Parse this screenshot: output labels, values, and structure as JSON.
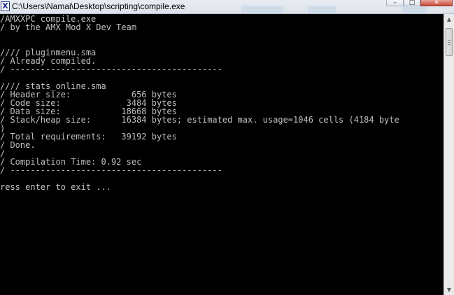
{
  "window": {
    "title": "C:\\Users\\Namai\\Desktop\\scripting\\compile.exe",
    "icon": "console-app-icon",
    "controls": {
      "minimize": "minimize-icon",
      "maximize": "maximize-icon",
      "close": "close-icon"
    }
  },
  "console": {
    "lines": [
      "/AMXXPC compile.exe",
      "/ by the AMX Mod X Dev Team",
      "",
      "",
      "//// pluginmenu.sma",
      "/ Already compiled.",
      "/ ------------------------------------------",
      "",
      "//// stats_online.sma",
      "/ Header size:            656 bytes",
      "/ Code size:             3484 bytes",
      "/ Data size:            18668 bytes",
      "/ Stack/heap size:      16384 bytes; estimated max. usage=1046 cells (4184 byte",
      ")",
      "/ Total requirements:   39192 bytes",
      "/ Done.",
      "/",
      "/ Compilation Time: 0.92 sec",
      "/ ------------------------------------------",
      "",
      "ress enter to exit ..."
    ]
  },
  "scrollbar": {
    "up": "scroll-up-icon",
    "down": "scroll-down-icon"
  },
  "colors": {
    "console_bg": "#000000",
    "console_fg": "#c0c0c0",
    "titlebar": "#e4e9f0"
  }
}
